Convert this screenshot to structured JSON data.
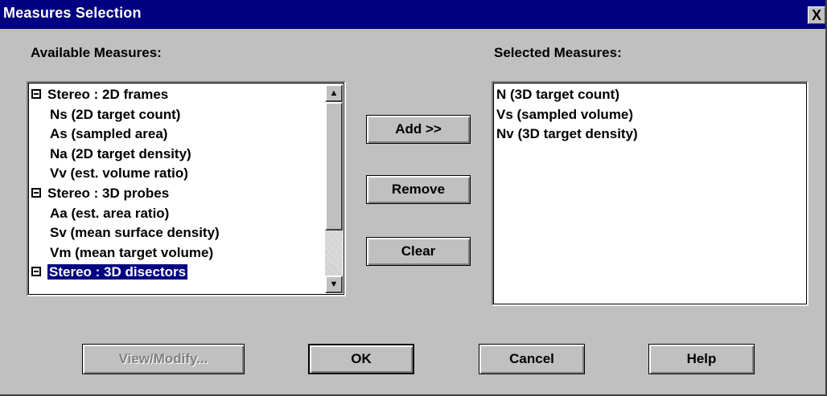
{
  "window": {
    "title": "Measures Selection",
    "close_label": "X"
  },
  "available": {
    "label": "Available Measures:",
    "items": [
      {
        "text": "Stereo : 2D frames",
        "group": true
      },
      {
        "text": "Ns (2D target count)",
        "group": false
      },
      {
        "text": "As (sampled area)",
        "group": false
      },
      {
        "text": "Na (2D target density)",
        "group": false
      },
      {
        "text": "Vv (est. volume ratio)",
        "group": false
      },
      {
        "text": "Stereo : 3D probes",
        "group": true
      },
      {
        "text": "Aa (est. area ratio)",
        "group": false
      },
      {
        "text": "Sv (mean surface density)",
        "group": false
      },
      {
        "text": "Vm (mean target volume)",
        "group": false
      },
      {
        "text": "Stereo : 3D disectors",
        "group": true,
        "selected": true
      }
    ]
  },
  "selected": {
    "label": "Selected Measures:",
    "items": [
      "N  (3D target count)",
      "Vs (sampled volume)",
      "Nv (3D target density)"
    ]
  },
  "buttons": {
    "add": "Add >>",
    "remove": "Remove",
    "clear": "Clear",
    "view_modify": "View/Modify...",
    "ok": "OK",
    "cancel": "Cancel",
    "help": "Help"
  },
  "icons": {
    "scroll_up": "▲",
    "scroll_down": "▼"
  },
  "colors": {
    "titlebar": "#000080",
    "selection": "#000080",
    "face": "#c0c0c0"
  }
}
